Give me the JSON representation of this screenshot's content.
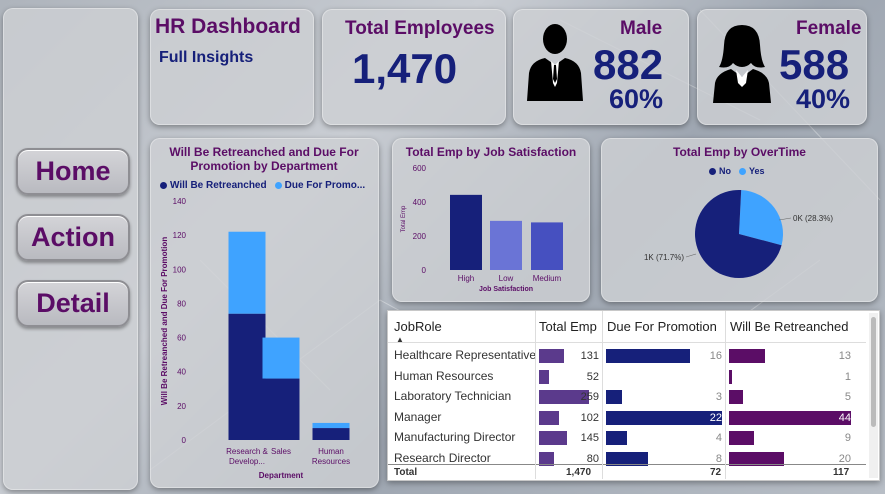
{
  "header": {
    "title": "HR Dashboard",
    "subtitle": "Full Insights",
    "total_label": "Total Employees",
    "total_value": "1,470",
    "male_label": "Male",
    "male_value": "882",
    "male_pct": "60%",
    "female_label": "Female",
    "female_value": "588",
    "female_pct": "40%"
  },
  "nav": {
    "home": "Home",
    "action": "Action",
    "detail": "Detail"
  },
  "colors": {
    "dark": "#16207a",
    "light": "#3fa3ff",
    "purple": "#5b0d66",
    "mid": "#6a74d6",
    "med2": "#4650c0"
  },
  "chart_data": [
    {
      "type": "bar",
      "title": "Will Be Retreanched and Due For Promotion by Department",
      "xlabel": "Department",
      "ylabel": "Will Be Retreanched and Due For Promotion",
      "ylim": [
        0,
        140
      ],
      "yticks": [
        "0",
        "20",
        "40",
        "60",
        "80",
        "100",
        "120",
        "140"
      ],
      "categories": [
        "Research & Develop...",
        "Sales",
        "Human Resources"
      ],
      "stacked": true,
      "legend": [
        "Will Be Retreanched",
        "Due For Promo..."
      ],
      "series": [
        {
          "name": "Will Be Retreanched",
          "values": [
            74,
            36,
            7
          ]
        },
        {
          "name": "Due For Promo...",
          "values": [
            48,
            24,
            3
          ]
        }
      ]
    },
    {
      "type": "bar",
      "title": "Total Emp by Job Satisfaction",
      "xlabel": "Job Satisfaction",
      "ylabel": "Total Emp",
      "ylim": [
        0,
        600
      ],
      "yticks": [
        "0",
        "200",
        "400",
        "600"
      ],
      "categories": [
        "High",
        "Low",
        "Medium"
      ],
      "values": [
        442,
        289,
        280
      ]
    },
    {
      "type": "pie",
      "title": "Total Emp by OverTime",
      "legend": [
        "No",
        "Yes"
      ],
      "labels": [
        "1K (71.7%)",
        "0K (28.3%)"
      ],
      "values": [
        1054,
        416
      ],
      "percent": [
        71.7,
        28.3
      ]
    }
  ],
  "table": {
    "headers": [
      "JobRole",
      "Total Emp",
      "Due For Promotion",
      "Will Be Retreanched"
    ],
    "rows": [
      {
        "role": "Healthcare Representative",
        "total": "131",
        "due": "16",
        "ret": "13",
        "t": 131,
        "d": 16,
        "r": 13
      },
      {
        "role": "Human Resources",
        "total": "52",
        "due": "",
        "ret": "1",
        "t": 52,
        "d": 0,
        "r": 1
      },
      {
        "role": "Laboratory Technician",
        "total": "259",
        "due": "3",
        "ret": "5",
        "t": 259,
        "d": 3,
        "r": 5
      },
      {
        "role": "Manager",
        "total": "102",
        "due": "22",
        "ret": "44",
        "t": 102,
        "d": 22,
        "r": 44
      },
      {
        "role": "Manufacturing Director",
        "total": "145",
        "due": "4",
        "ret": "9",
        "t": 145,
        "d": 4,
        "r": 9
      },
      {
        "role": "Research Director",
        "total": "80",
        "due": "8",
        "ret": "20",
        "t": 80,
        "d": 8,
        "r": 20
      }
    ],
    "total_label": "Total",
    "total_emp": "1,470",
    "total_due": "72",
    "total_ret": "117"
  }
}
